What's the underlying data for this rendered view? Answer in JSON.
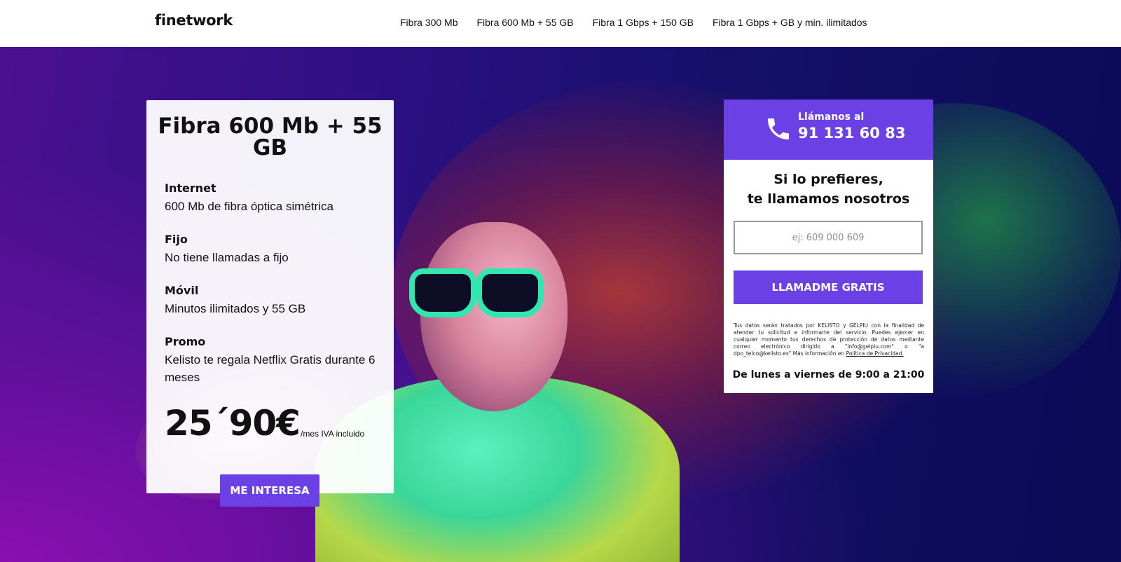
{
  "header": {
    "logo": "finetwork",
    "nav": [
      "Fibra 300 Mb",
      "Fibra 600 Mb + 55 GB",
      "Fibra 1 Gbps + 150 GB",
      "Fibra 1 Gbps + GB y min. ilimitados"
    ]
  },
  "offer": {
    "title": "Fibra 600 Mb + 55 GB",
    "features": [
      {
        "title": "Internet",
        "desc": "600 Mb de fibra óptica simétrica"
      },
      {
        "title": "Fijo",
        "desc": "No tiene llamadas a fijo"
      },
      {
        "title": "Móvil",
        "desc": "Minutos ilimitados y 55 GB"
      },
      {
        "title": "Promo",
        "desc": "Kelisto te regala Netflix Gratis durante 6 meses"
      }
    ],
    "price": "25´90€",
    "price_note": "/mes IVA incluido",
    "cta": "ME INTERESA"
  },
  "callbox": {
    "label": "Llámanos al",
    "phone": "91 131 60 83",
    "prefer_line1": "Si lo prefieres,",
    "prefer_line2": "te llamamos nosotros",
    "input_placeholder": "ej: 609 000 609",
    "button": "LLAMADME GRATIS",
    "legal_text": "Tus datos serán tratados por KELISTO y GELPIU con la finalidad de atender tu solicitud e informarte del servicio. Puedes ejercer en cualquier momento tus derechos de protección de datos mediante correo electrónico dirigido a \"info@gelpiu.com\" o \"a dpo_telco@kelisto.es\" Más información en ",
    "legal_link": "Política de Privacidad.",
    "hours": "De lunes a viernes de 9:00 a 21:00"
  },
  "colors": {
    "accent": "#6b41e6",
    "sunglasses": "#2ee8b0"
  }
}
